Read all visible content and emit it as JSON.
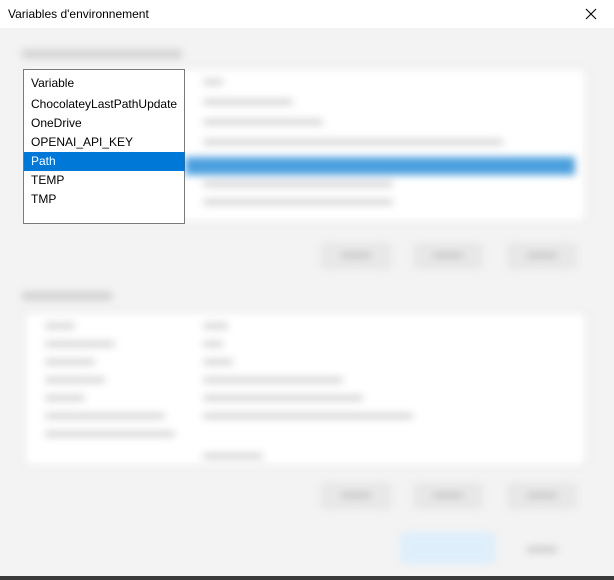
{
  "window": {
    "title": "Variables d'environnement",
    "close_icon": "close-icon"
  },
  "variable_list": {
    "header": "Variable",
    "items": [
      {
        "label": "ChocolateyLastPathUpdate"
      },
      {
        "label": "OneDrive"
      },
      {
        "label": "OPENAI_API_KEY"
      },
      {
        "label": "Path",
        "selected": true
      },
      {
        "label": "TEMP"
      },
      {
        "label": "TMP"
      }
    ]
  },
  "colors": {
    "selection": "#0078d7",
    "selection_text": "#ffffff",
    "window_bg": "#f3f3f3"
  }
}
